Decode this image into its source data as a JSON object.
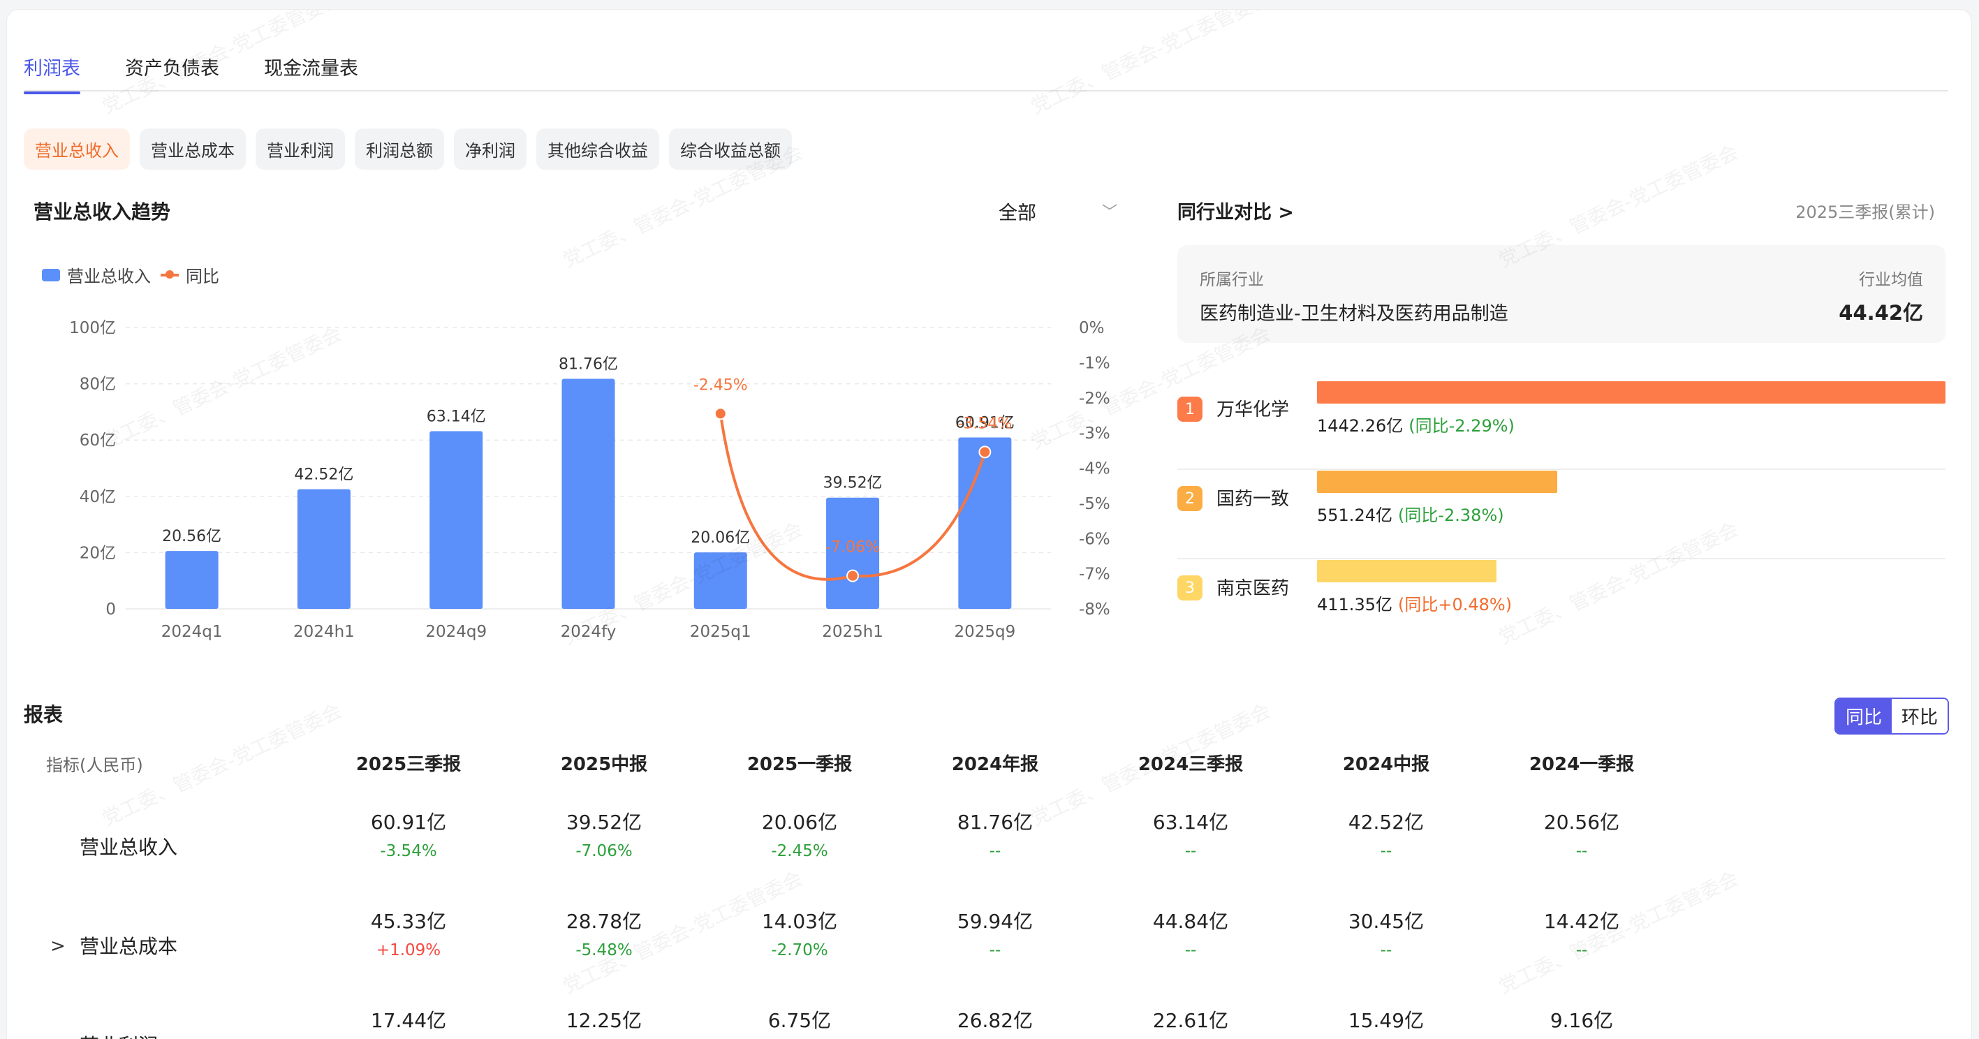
{
  "tabs": [
    "利润表",
    "资产负债表",
    "现金流量表"
  ],
  "chips": [
    "营业总收入",
    "营业总成本",
    "营业利润",
    "利润总额",
    "净利润",
    "其他综合收益",
    "综合收益总额"
  ],
  "trend": {
    "title": "营业总收入趋势",
    "range_value": "全部",
    "legend_bar": "营业总收入",
    "legend_line": "同比"
  },
  "chart_data": {
    "type": "bar",
    "title": "营业总收入趋势",
    "categories": [
      "2024q1",
      "2024h1",
      "2024q9",
      "2024fy",
      "2025q1",
      "2025h1",
      "2025q9"
    ],
    "series": [
      {
        "name": "营业总收入",
        "type": "bar",
        "values": [
          20.56,
          42.52,
          63.14,
          81.76,
          20.06,
          39.52,
          60.91
        ],
        "labels": [
          "20.56亿",
          "42.52亿",
          "63.14亿",
          "81.76亿",
          "20.06亿",
          "39.52亿",
          "60.91亿"
        ],
        "color": "#5b8ff9"
      },
      {
        "name": "同比",
        "type": "line",
        "values": [
          null,
          null,
          null,
          null,
          -2.45,
          -7.06,
          -3.54
        ],
        "labels": [
          "",
          "",
          "",
          "",
          "-2.45%",
          "-7.06%",
          "-3.54%"
        ],
        "color": "#f6763f"
      }
    ],
    "y_left": {
      "ticks": [
        "100亿",
        "80亿",
        "60亿",
        "40亿",
        "20亿",
        "0"
      ],
      "ylim": [
        0,
        100
      ]
    },
    "y_right": {
      "ticks": [
        "0%",
        "-1%",
        "-2%",
        "-3%",
        "-4%",
        "-5%",
        "-6%",
        "-7%",
        "-8%"
      ],
      "ylim": [
        -8,
        0
      ]
    }
  },
  "peer": {
    "title": "同行业对比 >",
    "period": "2025三季报(累计)",
    "industry_label": "所属行业",
    "industry_name": "医药制造业-卫生材料及医药用品制造",
    "avg_label": "行业均值",
    "avg_value": "44.42亿",
    "rows": [
      {
        "rank": "1",
        "name": "万华化学",
        "value": "1442.26亿",
        "change": "(同比-2.29%)",
        "ratio": 1.0,
        "color": "#fd7b48",
        "rank_color": "#fd7b48",
        "chg_color": "green"
      },
      {
        "rank": "2",
        "name": "国药一致",
        "value": "551.24亿",
        "change": "(同比-2.38%)",
        "ratio": 0.382,
        "color": "#fbac42",
        "rank_color": "#fbac42",
        "chg_color": "green"
      },
      {
        "rank": "3",
        "name": "南京医药",
        "value": "411.35亿",
        "change": "(同比+0.48%)",
        "ratio": 0.285,
        "color": "#fed665",
        "rank_color": "#fed665",
        "chg_color": "orange"
      }
    ]
  },
  "report": {
    "title": "报表",
    "toggle_yoy": "同比",
    "toggle_qoq": "环比",
    "first_col": "指标(人民币)",
    "columns": [
      "2025三季报",
      "2025中报",
      "2025一季报",
      "2024年报",
      "2024三季报",
      "2024中报",
      "2024一季报"
    ],
    "rows": [
      {
        "label": "营业总收入",
        "expand": "",
        "values": [
          "60.91亿",
          "39.52亿",
          "20.06亿",
          "81.76亿",
          "63.14亿",
          "42.52亿",
          "20.56亿"
        ],
        "changes": [
          "-3.54%",
          "-7.06%",
          "-2.45%",
          "--",
          "--",
          "--",
          "--"
        ]
      },
      {
        "label": "营业总成本",
        "expand": ">",
        "values": [
          "45.33亿",
          "28.78亿",
          "14.03亿",
          "59.94亿",
          "44.84亿",
          "30.45亿",
          "14.42亿"
        ],
        "changes": [
          "+1.09%",
          "-5.48%",
          "-2.70%",
          "--",
          "--",
          "--",
          "--"
        ]
      },
      {
        "label": "营业利润",
        "expand": ">",
        "values": [
          "17.44亿",
          "12.25亿",
          "6.75亿",
          "26.82亿",
          "22.61亿",
          "15.49亿",
          "9.16亿"
        ],
        "changes": [
          "",
          "",
          "",
          "",
          "",
          "",
          ""
        ]
      }
    ]
  },
  "watermark": "党工委、管委会-党工委管委会"
}
